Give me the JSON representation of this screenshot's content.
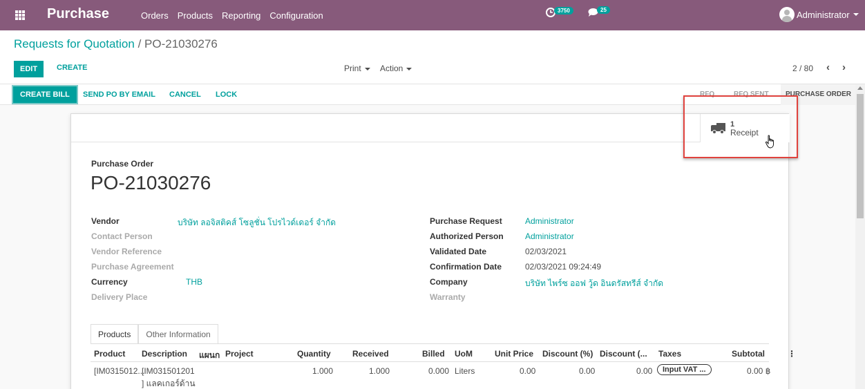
{
  "navbar": {
    "app_name": "Purchase",
    "menu": [
      "Orders",
      "Products",
      "Reporting",
      "Configuration"
    ],
    "activity_count": "3750",
    "message_count": "25",
    "user": "Administrator"
  },
  "control_panel": {
    "breadcrumb_parent": "Requests for Quotation",
    "breadcrumb_sep": "/",
    "breadcrumb_current": "PO-21030276",
    "edit_label": "EDIT",
    "create_label": "CREATE",
    "print_label": "Print",
    "action_label": "Action",
    "pager": "2 / 80"
  },
  "statusbar": {
    "create_bill": "CREATE BILL",
    "send_po": "SEND PO BY EMAIL",
    "cancel": "CANCEL",
    "lock": "LOCK",
    "stages": [
      "RFQ",
      "RFQ SENT",
      "PURCHASE ORDER"
    ],
    "active_stage": "PURCHASE ORDER"
  },
  "smart_button": {
    "count": "1",
    "label": "Receipt"
  },
  "form": {
    "title_label": "Purchase Order",
    "name": "PO-21030276",
    "left_fields": [
      {
        "label": "Vendor",
        "value": "บริษัท ลอจิสติคส์ โซลูชั่น โปรไวด์เดอร์ จำกัด"
      },
      {
        "label": "Contact Person",
        "value": ""
      },
      {
        "label": "Vendor Reference",
        "value": ""
      },
      {
        "label": "Purchase Agreement",
        "value": ""
      },
      {
        "label": "Currency",
        "value": "THB"
      },
      {
        "label": "Delivery Place",
        "value": ""
      }
    ],
    "right_fields": [
      {
        "label": "Purchase Request",
        "value": "Administrator"
      },
      {
        "label": "Authorized Person",
        "value": "Administrator"
      },
      {
        "label": "Validated Date",
        "value": "02/03/2021"
      },
      {
        "label": "Confirmation Date",
        "value": "02/03/2021 09:24:49"
      },
      {
        "label": "Company",
        "value": "บริษัท ไพร์ซ ออฟ วู้ด อินดรัสทรีส์ จำกัด"
      },
      {
        "label": "Warranty",
        "value": ""
      }
    ]
  },
  "tabs": [
    "Products",
    "Other Information"
  ],
  "table": {
    "columns": [
      "Product",
      "Description",
      "แผนก",
      "Project",
      "Quantity",
      "Received",
      "Billed",
      "UoM",
      "Unit Price",
      "Discount (%)",
      "Discount (...",
      "Taxes",
      "Subtotal"
    ],
    "rows": [
      {
        "product": "[IM0315012...",
        "description_line1": "[IM031501201",
        "description_line2": "] แลคเกอร์ด้าน",
        "department": "",
        "project": "",
        "quantity": "1.000",
        "received": "1.000",
        "billed": "0.000",
        "uom": "Liters",
        "unit_price": "0.00",
        "discount_pct": "0.00",
        "discount_amt": "0.00",
        "taxes": "Input VAT ...",
        "subtotal": "0.00 ฿"
      }
    ]
  },
  "colors": {
    "navbar": "#875a7b",
    "primary": "#00a09d",
    "highlight": "#e0423d"
  }
}
